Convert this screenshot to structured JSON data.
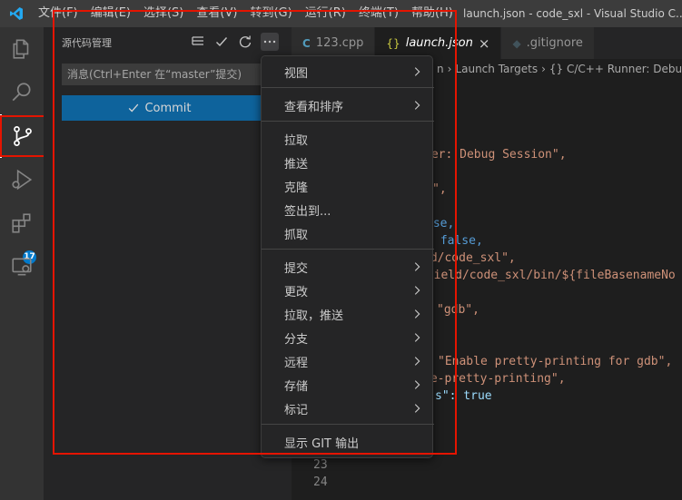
{
  "window": {
    "title": "launch.json - code_sxl - Visual Studio C..."
  },
  "menubar": {
    "items": [
      "文件(F)",
      "编辑(E)",
      "选择(S)",
      "查看(V)",
      "转到(G)",
      "运行(R)",
      "终端(T)",
      "帮助(H)"
    ]
  },
  "activitybar": {
    "extensions_badge": "17"
  },
  "scm": {
    "title": "源代码管理",
    "commit_placeholder": "消息(Ctrl+Enter 在“master”提交)",
    "commit_label": "Commit"
  },
  "tabs": [
    {
      "label": "123.cpp",
      "icon": "cpp-file-icon"
    },
    {
      "label": "launch.json",
      "icon": "json-braces-icon",
      "close": "×"
    },
    {
      "label": ".gitignore",
      "icon": "git-file-icon"
    }
  ],
  "breadcrumb": {
    "parts": [
      "n",
      "Launch Targets",
      "{} C/C++ Runner: Debug S"
    ]
  },
  "editor": {
    "lines": [
      {
        "text": "ner: Debug Session\",",
        "class": "str_tail"
      },
      {
        "text": "\","
      },
      {
        "text": "lse,"
      },
      {
        "text": " false,"
      },
      {
        "text": "ld/code_sxl\","
      },
      {
        "text": "efield/code_sxl/bin/${fileBasenameNo"
      },
      {
        "text": "\"gdb\","
      },
      {
        "text": "\"Enable pretty-printing for gdb\","
      },
      {
        "text": "le-pretty-printing\","
      },
      {
        "text": "s\": true"
      }
    ],
    "line_numbers": [
      "23",
      "24"
    ]
  },
  "context_menu": {
    "items": [
      {
        "label": "视图",
        "submenu": true
      },
      {
        "label": "查看和排序",
        "submenu": true
      },
      {
        "label": "拉取",
        "submenu": false
      },
      {
        "label": "推送",
        "submenu": false
      },
      {
        "label": "克隆",
        "submenu": false
      },
      {
        "label": "签出到...",
        "submenu": false
      },
      {
        "label": "抓取",
        "submenu": false
      },
      {
        "label": "提交",
        "submenu": true
      },
      {
        "label": "更改",
        "submenu": true
      },
      {
        "label": "拉取，推送",
        "submenu": true
      },
      {
        "label": "分支",
        "submenu": true
      },
      {
        "label": "远程",
        "submenu": true
      },
      {
        "label": "存储",
        "submenu": true
      },
      {
        "label": "标记",
        "submenu": true
      },
      {
        "label": "显示 GIT 输出",
        "submenu": false
      }
    ]
  },
  "colors": {
    "accent": "#007acc",
    "commit_button": "#0e639c",
    "highlight": "#e51400"
  }
}
